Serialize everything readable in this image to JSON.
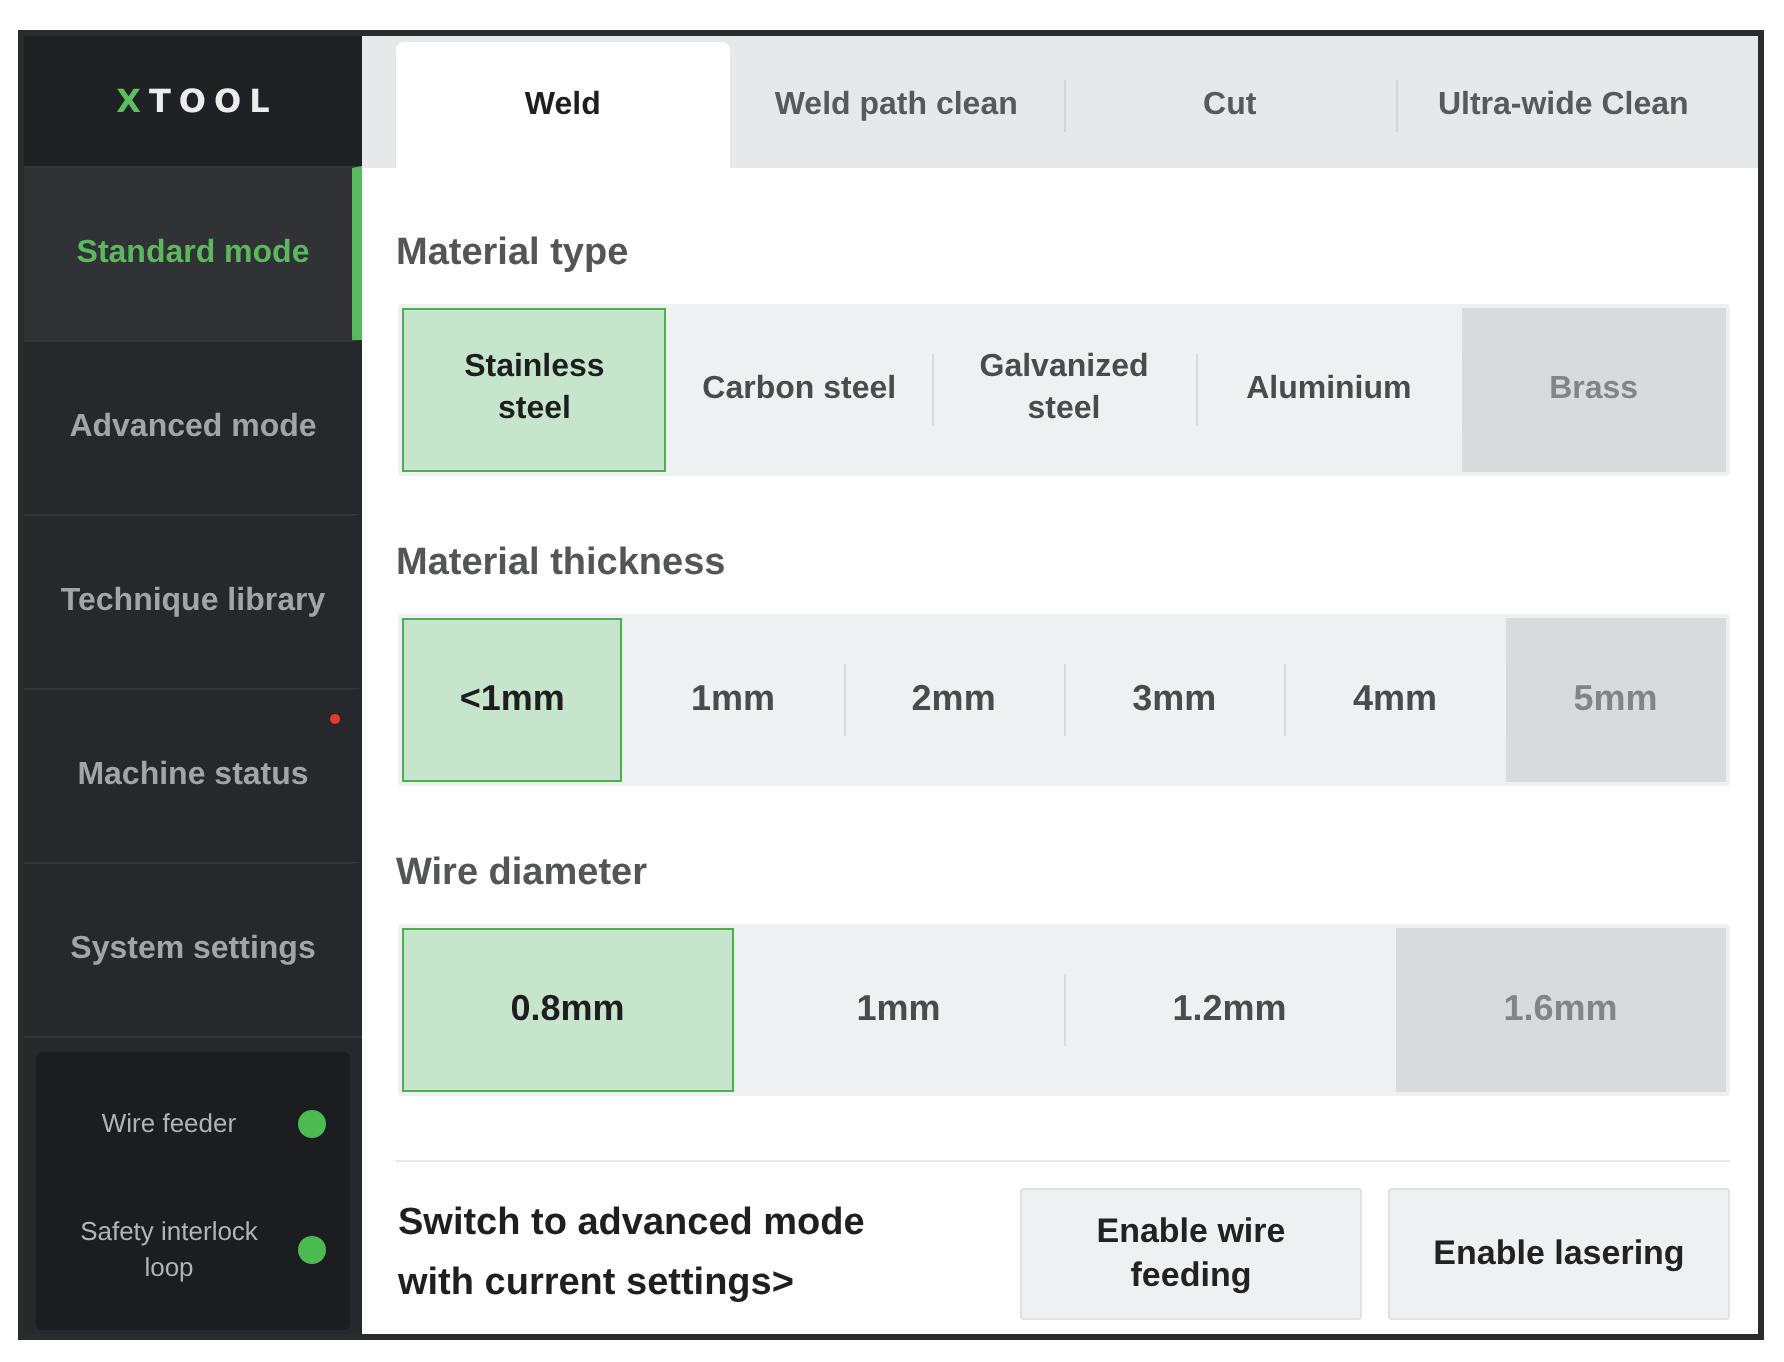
{
  "logo": {
    "text": "XTOOL"
  },
  "sidebar": {
    "items": [
      {
        "label": "Standard mode",
        "selected": true,
        "alert": false
      },
      {
        "label": "Advanced mode",
        "selected": false,
        "alert": false
      },
      {
        "label": "Technique library",
        "selected": false,
        "alert": false
      },
      {
        "label": "Machine status",
        "selected": false,
        "alert": true
      },
      {
        "label": "System settings",
        "selected": false,
        "alert": false
      }
    ]
  },
  "status_panel": {
    "items": [
      {
        "label": "Wire feeder",
        "color": "#4cbb4f"
      },
      {
        "label": "Safety interlock loop",
        "color": "#4cbb4f"
      }
    ]
  },
  "tabs": [
    {
      "label": "Weld",
      "selected": true
    },
    {
      "label": "Weld path clean",
      "selected": false
    },
    {
      "label": "Cut",
      "selected": false
    },
    {
      "label": "Ultra-wide Clean",
      "selected": false
    }
  ],
  "sections": [
    {
      "title": "Material type",
      "options": [
        {
          "label": "Stainless steel",
          "selected": true,
          "disabled": false
        },
        {
          "label": "Carbon steel",
          "selected": false,
          "disabled": false
        },
        {
          "label": "Galvanized steel",
          "selected": false,
          "disabled": false
        },
        {
          "label": "Aluminium",
          "selected": false,
          "disabled": false
        },
        {
          "label": "Brass",
          "selected": false,
          "disabled": true
        }
      ]
    },
    {
      "title": "Material thickness",
      "options": [
        {
          "label": "<1mm",
          "selected": true,
          "disabled": false
        },
        {
          "label": "1mm",
          "selected": false,
          "disabled": false
        },
        {
          "label": "2mm",
          "selected": false,
          "disabled": false
        },
        {
          "label": "3mm",
          "selected": false,
          "disabled": false
        },
        {
          "label": "4mm",
          "selected": false,
          "disabled": false
        },
        {
          "label": "5mm",
          "selected": false,
          "disabled": true
        }
      ]
    },
    {
      "title": "Wire diameter",
      "options": [
        {
          "label": "0.8mm",
          "selected": true,
          "disabled": false
        },
        {
          "label": "1mm",
          "selected": false,
          "disabled": false
        },
        {
          "label": "1.2mm",
          "selected": false,
          "disabled": false
        },
        {
          "label": "1.6mm",
          "selected": false,
          "disabled": true
        }
      ]
    }
  ],
  "footer": {
    "link": "Switch to advanced mode with current settings>",
    "buttons": [
      {
        "label": "Enable wire feeding"
      },
      {
        "label": "Enable lasering"
      }
    ]
  }
}
